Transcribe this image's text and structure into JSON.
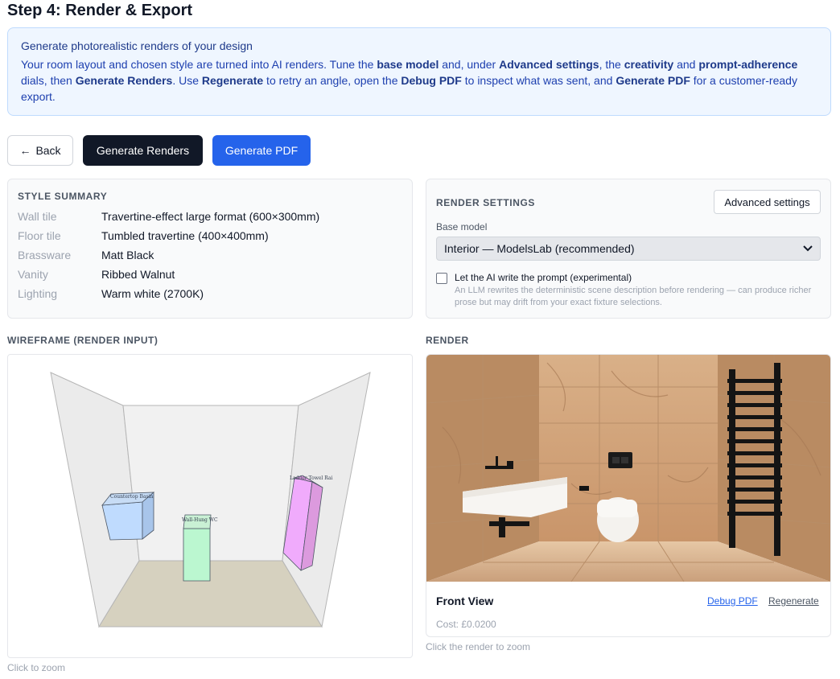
{
  "page": {
    "title": "Step 4: Render & Export"
  },
  "info": {
    "title": "Generate photorealistic renders of your design",
    "parts": [
      {
        "t": "Your room layout and chosen style are turned into AI renders. Tune the ",
        "b": false
      },
      {
        "t": "base model",
        "b": true
      },
      {
        "t": " and, under ",
        "b": false
      },
      {
        "t": "Advanced settings",
        "b": true
      },
      {
        "t": ", the ",
        "b": false
      },
      {
        "t": "creativity",
        "b": true
      },
      {
        "t": " and ",
        "b": false
      },
      {
        "t": "prompt-adherence",
        "b": true
      },
      {
        "t": " dials, then ",
        "b": false
      },
      {
        "t": "Generate Renders",
        "b": true
      },
      {
        "t": ". Use ",
        "b": false
      },
      {
        "t": "Regenerate",
        "b": true
      },
      {
        "t": " to retry an angle, open the ",
        "b": false
      },
      {
        "t": "Debug PDF",
        "b": true
      },
      {
        "t": " to inspect what was sent, and ",
        "b": false
      },
      {
        "t": "Generate PDF",
        "b": true
      },
      {
        "t": " for a customer-ready export.",
        "b": false
      }
    ]
  },
  "actions": {
    "back_label": "Back",
    "back_icon": "arrow-left-icon",
    "generate_renders_label": "Generate Renders",
    "generate_pdf_label": "Generate PDF"
  },
  "style_summary": {
    "heading": "STYLE SUMMARY",
    "rows": [
      {
        "key": "Wall tile",
        "value": "Travertine-effect large format (600×300mm)"
      },
      {
        "key": "Floor tile",
        "value": "Tumbled travertine (400×400mm)"
      },
      {
        "key": "Brassware",
        "value": "Matt Black"
      },
      {
        "key": "Vanity",
        "value": "Ribbed Walnut"
      },
      {
        "key": "Lighting",
        "value": "Warm white (2700K)"
      }
    ]
  },
  "render_settings": {
    "heading": "RENDER SETTINGS",
    "advanced_label": "Advanced settings",
    "base_model_label": "Base model",
    "base_model_value": "Interior — ModelsLab (recommended)",
    "ai_prompt_label": "Let the AI write the prompt (experimental)",
    "ai_prompt_checked": false,
    "ai_prompt_help": "An LLM rewrites the deterministic scene description before rendering — can produce richer prose but may drift from your exact fixture selections."
  },
  "wireframe": {
    "heading": "WIREFRAME (RENDER INPUT)",
    "labels": {
      "basin": "Countertop Basin",
      "wc": "Wall-Hung WC",
      "rail": "Ladder Towel Rai"
    },
    "hint": "Click to zoom"
  },
  "render": {
    "heading": "RENDER",
    "view_name": "Front View",
    "debug_label": "Debug PDF",
    "regenerate_label": "Regenerate",
    "cost": "Cost: £0.0200",
    "hint": "Click the render to zoom"
  },
  "colors": {
    "primary": "#2563eb",
    "dark": "#111827",
    "info_bg": "#eff6ff",
    "basin_fill": "#bfdbfe",
    "wc_fill": "#bbf7d0",
    "rail_fill": "#f0abfc",
    "tile": "#d2a37a"
  }
}
